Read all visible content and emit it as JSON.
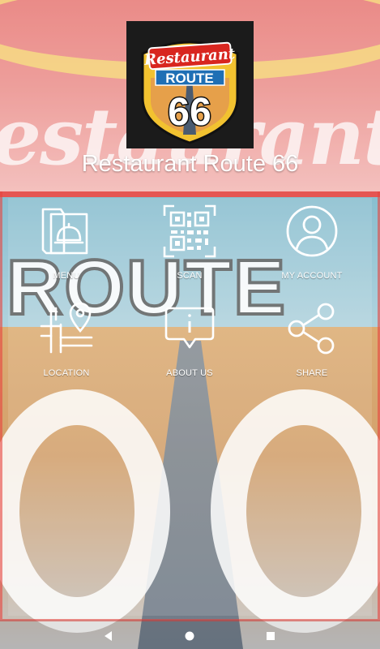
{
  "app": {
    "title": "Restaurant Route 66"
  },
  "logo": {
    "line1": "Restaurant",
    "line2": "ROUTE",
    "line3": "66"
  },
  "menu": [
    {
      "label": "MENU",
      "icon": "menu-cloche-icon"
    },
    {
      "label": "SCAN",
      "icon": "qr-code-icon"
    },
    {
      "label": "MY ACCOUNT",
      "icon": "user-account-icon"
    },
    {
      "label": "LOCATION",
      "icon": "map-pin-icon"
    },
    {
      "label": "ABOUT US",
      "icon": "info-chat-icon"
    },
    {
      "label": "SHARE",
      "icon": "share-icon"
    }
  ],
  "navbar": {
    "back": "◀",
    "home": "●",
    "recent": "■"
  },
  "colors": {
    "text": "#ffffff",
    "accent_red": "#e0302c",
    "shield_yellow": "#f2c230"
  }
}
